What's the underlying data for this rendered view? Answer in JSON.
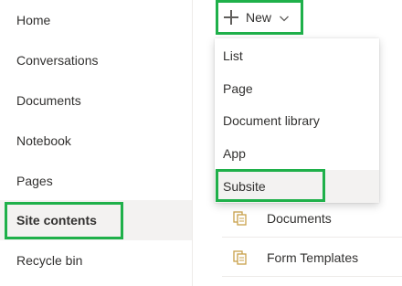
{
  "nav": {
    "items": [
      {
        "label": "Home"
      },
      {
        "label": "Conversations"
      },
      {
        "label": "Documents"
      },
      {
        "label": "Notebook"
      },
      {
        "label": "Pages"
      },
      {
        "label": "Site contents",
        "selected": true
      },
      {
        "label": "Recycle bin"
      }
    ]
  },
  "command_bar": {
    "new_label": "New"
  },
  "new_menu": {
    "items": [
      {
        "label": "List"
      },
      {
        "label": "Page"
      },
      {
        "label": "Document library"
      },
      {
        "label": "App"
      },
      {
        "label": "Subsite",
        "hovered": true
      }
    ]
  },
  "content_list": {
    "rows": [
      {
        "name": "Documents"
      },
      {
        "name": "Form Templates"
      }
    ]
  },
  "colors": {
    "highlight_box": "#1fb04a",
    "selected_bg": "#f3f2f1",
    "folder_icon": "#c8a04a"
  },
  "icons": {
    "new_button": "plus-icon",
    "new_dropdown": "chevron-down-icon",
    "list_row": "document-library-icon"
  }
}
